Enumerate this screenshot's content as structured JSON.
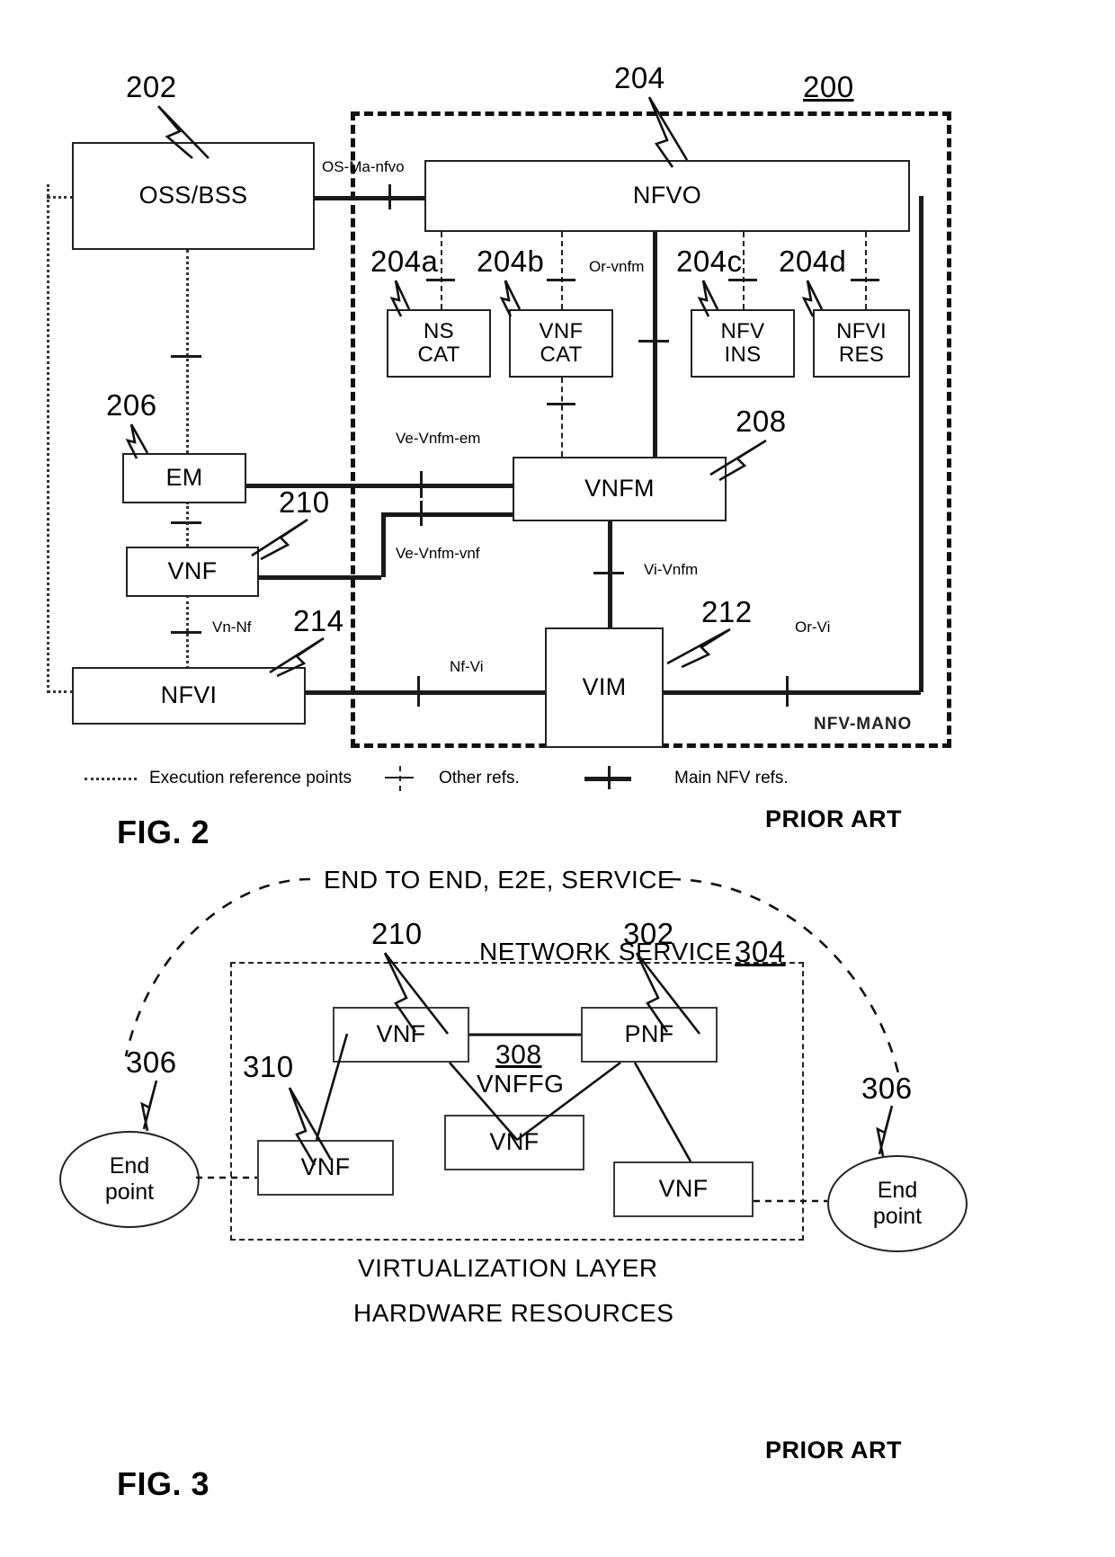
{
  "figure2": {
    "caption": "FIG. 2",
    "prior_art": "PRIOR ART",
    "system_numeral": "200",
    "mano_label": "NFV-MANO",
    "boxes": {
      "oss_bss": "OSS/BSS",
      "nfvo": "NFVO",
      "ns_cat": "NS\nCAT",
      "ns_cat_l1": "NS",
      "ns_cat_l2": "CAT",
      "vnf_cat_l1": "VNF",
      "vnf_cat_l2": "CAT",
      "nfv_ins_l1": "NFV",
      "nfv_ins_l2": "INS",
      "nfvi_res_l1": "NFVI",
      "nfvi_res_l2": "RES",
      "em": "EM",
      "vnf": "VNF",
      "vnfm": "VNFM",
      "vim": "VIM",
      "nfvi": "NFVI"
    },
    "numerals": {
      "oss_bss": "202",
      "nfvo": "204",
      "ns_cat": "204a",
      "vnf_cat": "204b",
      "nfv_ins": "204c",
      "nfvi_res": "204d",
      "em": "206",
      "vnfm": "208",
      "vnf": "210",
      "vim": "212",
      "nfvi": "214"
    },
    "interfaces": {
      "os_ma_nfvo": "OS-Ma-nfvo",
      "or_vnfm": "Or-vnfm",
      "ve_vnfm_em": "Ve-Vnfm-em",
      "ve_vnfm_vnf": "Ve-Vnfm-vnf",
      "vi_vnfm": "Vi-Vnfm",
      "vn_nf": "Vn-Nf",
      "nf_vi": "Nf-Vi",
      "or_vi": "Or-Vi"
    },
    "legend": {
      "execution": "Execution reference points",
      "other": "Other refs.",
      "main": "Main NFV refs."
    }
  },
  "figure3": {
    "caption": "FIG. 3",
    "prior_art": "PRIOR ART",
    "e2e_title": "END TO END, E2E, SERVICE",
    "network_service_title": "NETWORK SERVICE",
    "network_service_numeral": "304",
    "vnffg_numeral": "308",
    "vnffg_label": "VNFFG",
    "virtualization_layer": "VIRTUALIZATION LAYER",
    "hardware_resources": "HARDWARE RESOURCES",
    "numerals": {
      "vnf_top": "210",
      "pnf": "302",
      "endpoint_left": "306",
      "endpoint_right": "306",
      "vnf_lower_left": "310"
    },
    "boxes": {
      "vnf_top": "VNF",
      "pnf": "PNF",
      "vnf_mid": "VNF",
      "vnf_bottom_left": "VNF",
      "vnf_bottom_right": "VNF"
    },
    "endpoints": {
      "left_l1": "End",
      "left_l2": "point",
      "right_l1": "End",
      "right_l2": "point"
    }
  },
  "colors": {
    "ink": "#111111",
    "paper": "#ffffff"
  }
}
